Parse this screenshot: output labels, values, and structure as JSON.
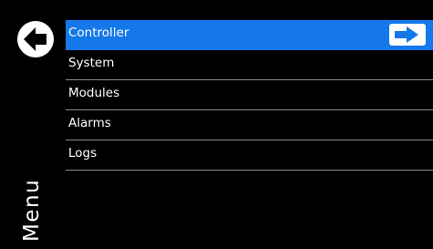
{
  "screen": {
    "title": "Menu",
    "back_icon": "back-arrow-icon",
    "accent_color": "#1478ea"
  },
  "menu": {
    "items": [
      {
        "label": "Controller",
        "selected": true,
        "icon": "arrow-right-icon"
      },
      {
        "label": "System",
        "selected": false
      },
      {
        "label": "Modules",
        "selected": false
      },
      {
        "label": "Alarms",
        "selected": false
      },
      {
        "label": "Logs",
        "selected": false
      }
    ]
  }
}
